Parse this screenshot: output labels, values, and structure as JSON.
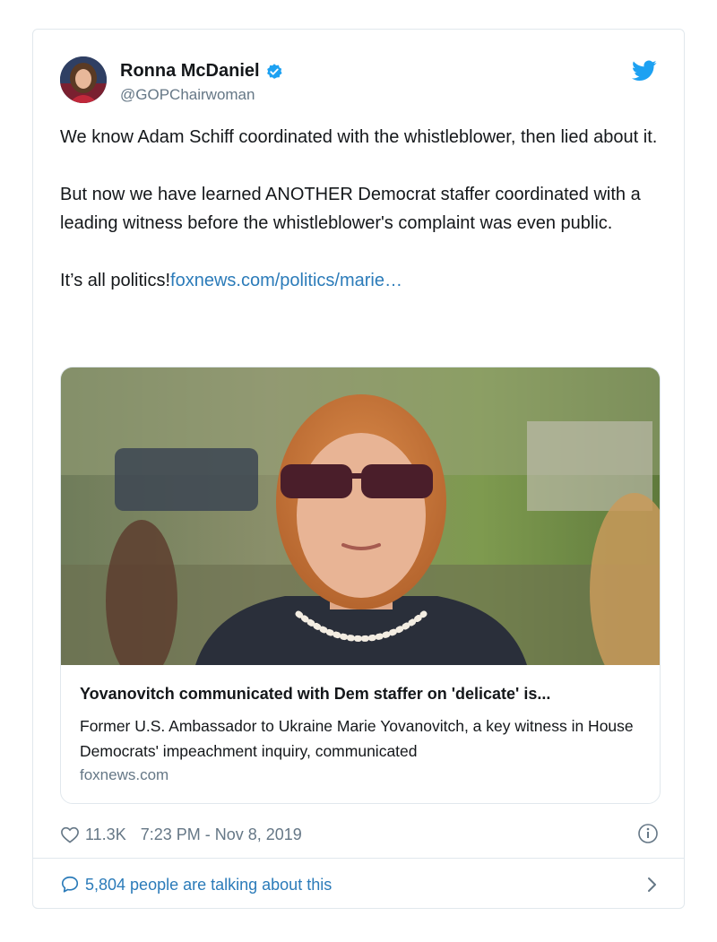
{
  "author": {
    "name": "Ronna McDaniel",
    "handle": "@GOPChairwoman",
    "verified": true,
    "avatar_icon": "avatar-photo"
  },
  "tweet": {
    "paragraph_1": "We know Adam Schiff coordinated with the whistleblower, then lied about it.",
    "paragraph_2": "But now we have learned ANOTHER Democrat staffer coordinated with a leading witness before the whistleblower's complaint was even public.",
    "paragraph_3_text": "It’s all politics!",
    "paragraph_3_link": "foxnews.com/politics/marie…"
  },
  "link_card": {
    "title": "Yovanovitch communicated with Dem staffer on 'delicate' is...",
    "description": "Former U.S. Ambassador to Ukraine Marie Yovanovitch, a key witness in House Democrats' impeachment inquiry, communicated",
    "domain": "foxnews.com"
  },
  "meta": {
    "likes": "11.3K",
    "timestamp": "7:23 PM - Nov 8, 2019"
  },
  "footer": {
    "talking": "5,804 people are talking about this"
  },
  "colors": {
    "link": "#2b7bb9",
    "twitter_blue": "#1da1f2",
    "muted": "#657786",
    "border": "#e1e8ed"
  }
}
